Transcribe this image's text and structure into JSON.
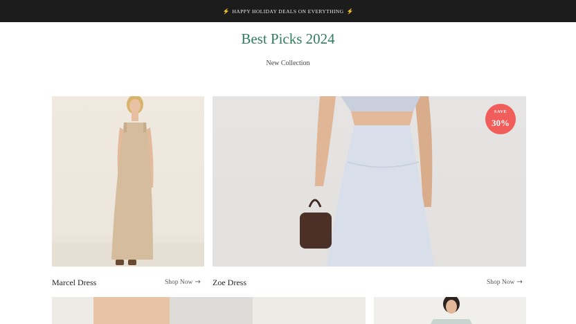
{
  "announcement": {
    "icon": "lightning-icon",
    "text": "HAPPY HOLIDAY DEALS ON EVERYTHING",
    "bolt_glyph": "⚡"
  },
  "section": {
    "title": "Best Picks 2024",
    "subtitle": "New Collection"
  },
  "products": [
    {
      "name": "Marcel Dress",
      "cta": "Shop Now"
    },
    {
      "name": "Zoe Dress",
      "cta": "Shop Now"
    }
  ],
  "badge": {
    "line1": "SAVE",
    "line2": "30%"
  },
  "colors": {
    "announcement_bg": "#1c1c1c",
    "title": "#2e7d5b",
    "badge": "#f15d5a"
  }
}
